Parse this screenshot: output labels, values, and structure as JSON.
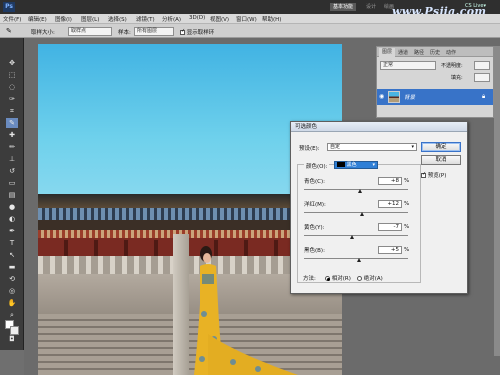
{
  "app": {
    "logo": "Ps",
    "workspace_active": "基本功能",
    "workspace_2": "设计",
    "workspace_3": "绘画",
    "cs_live": "CS Live▾",
    "watermark": "www.Psjia.com"
  },
  "menu": [
    "文件(F)",
    "编辑(E)",
    "图像(I)",
    "图层(L)",
    "选择(S)",
    "滤镜(T)",
    "分析(A)",
    "3D(D)",
    "视图(V)",
    "窗口(W)",
    "帮助(H)"
  ],
  "options": {
    "sample_size_label": "取样大小:",
    "sample_size_value": "取样点",
    "sample_label": "样本:",
    "sample_value": "所有图层",
    "show_ring_label": "显示取样环"
  },
  "layers_panel": {
    "tabs": [
      "图层",
      "通道",
      "路径",
      "历史",
      "动作"
    ],
    "blend_mode": "正常",
    "opacity_label": "不透明度:",
    "fill_label": "填充:",
    "layer_name": "背景"
  },
  "dialog": {
    "title": "可选颜色",
    "preset_label": "预设(E):",
    "preset_value": "自定",
    "colors_label": "颜色(O):",
    "colors_value": "黑色",
    "ok": "确定",
    "cancel": "取消",
    "preview_label": "预览(P)",
    "rows": [
      {
        "label": "青色(C):",
        "value": "+8",
        "unit": "%",
        "pos": 0.54
      },
      {
        "label": "洋红(M):",
        "value": "+12",
        "unit": "%",
        "pos": 0.56
      },
      {
        "label": "黄色(Y):",
        "value": "-7",
        "unit": "%",
        "pos": 0.465
      },
      {
        "label": "黑色(B):",
        "value": "+5",
        "unit": "%",
        "pos": 0.525
      }
    ],
    "method_label": "方法:",
    "relative_label": "相对(R)",
    "absolute_label": "绝对(A)"
  }
}
